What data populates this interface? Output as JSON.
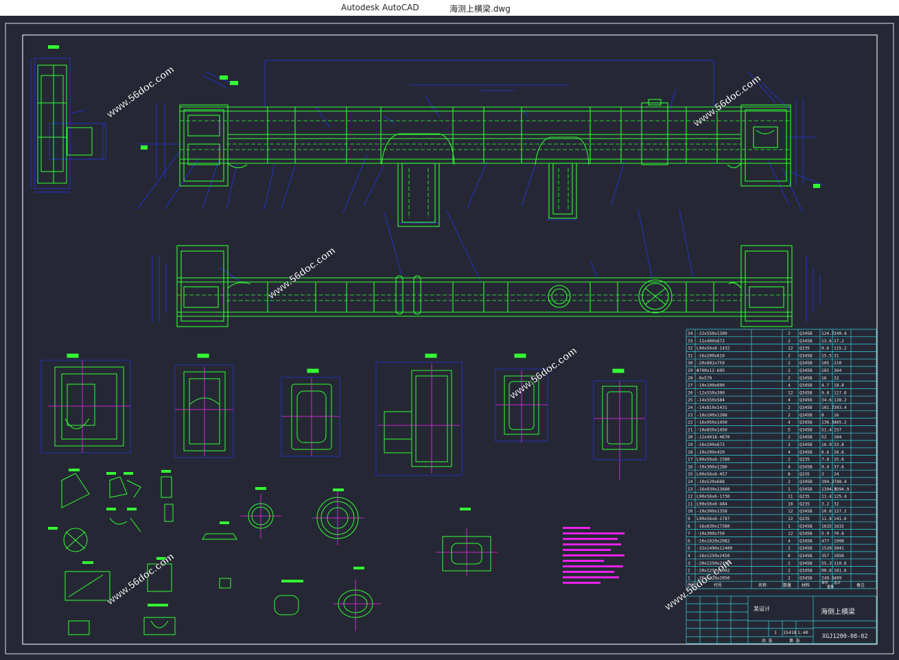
{
  "window": {
    "app_name": "Autodesk AutoCAD",
    "file_name": "海测上横梁.dwg"
  },
  "watermark": "www.56doc.com",
  "colors": {
    "background": "#252834",
    "frame": "#dfe4ea",
    "green": "#33ff33",
    "blue": "#2233ee",
    "cyan": "#33d6e6",
    "magenta": "#ff22ff",
    "white": "#e8e8e8",
    "watermark": "#ffffff"
  },
  "parts_table": {
    "rows": [
      [
        "34",
        "-22x550x1380",
        "2",
        "Q345B",
        "124.7",
        "249.4"
      ],
      [
        "33",
        "-11x400x672",
        "2",
        "Q345B",
        "13.6",
        "27.2"
      ],
      [
        "32",
        "L90x56x6-1432",
        "12",
        "Q235",
        "9.6",
        "115.2"
      ],
      [
        "31",
        "-16x200x616",
        "2",
        "Q345B",
        "15.5",
        "31"
      ],
      [
        "30",
        "-20x882x759",
        "2",
        "Q345B",
        "105",
        "210"
      ],
      [
        "29",
        "Φ700x12-695",
        "2",
        "Q345B",
        "182",
        "364"
      ],
      [
        "28",
        "-8x570",
        "2",
        "Q345B",
        "16",
        "32"
      ],
      [
        "27",
        "-10x100x600",
        "4",
        "Q345B",
        "4.7",
        "18.8"
      ],
      [
        "26",
        "-12x550x300",
        "12",
        "Q345B",
        "9.8",
        "117.6"
      ],
      [
        "25",
        "-14x550x584",
        "4",
        "Q345B",
        "34.6",
        "138.2"
      ],
      [
        "24",
        "-14x810x1431",
        "2",
        "Q345B",
        "101.7",
        "203.4"
      ],
      [
        "23",
        "-10x100x1288",
        "2",
        "Q345B",
        "8",
        "16"
      ],
      [
        "22",
        "-16x950x1450",
        "4",
        "Q345B",
        "136.3",
        "465.2"
      ],
      [
        "21",
        "-10x850x1450",
        "5",
        "Q345B",
        "51.4",
        "257"
      ],
      [
        "20",
        "-12x4918-4670",
        "2",
        "Q345B",
        "52",
        "104"
      ],
      [
        "19",
        "-16x200x672",
        "2",
        "Q345B",
        "16.9",
        "33.8"
      ],
      [
        "18",
        "-10x200x420",
        "4",
        "Q345B",
        "6.6",
        "26.6"
      ],
      [
        "17",
        "L90x56x6-2380",
        "2",
        "Q235",
        "7.8",
        "15.6"
      ],
      [
        "16",
        "-10x300x1280",
        "4",
        "Q345B",
        "9.4",
        "37.6"
      ],
      [
        "15",
        "L90x56x6-457",
        "8",
        "Q235",
        "3",
        "24"
      ],
      [
        "14",
        "-10x520x688",
        "2",
        "Q345B",
        "394.2",
        "788.4"
      ],
      [
        "13",
        "-16x930x13680",
        "1",
        "Q345B",
        "1394.9",
        "1394.9"
      ],
      [
        "12",
        "L90x56x6-1730",
        "11",
        "Q235",
        "11.4",
        "125.4"
      ],
      [
        "11",
        "L90x56x6-484",
        "10",
        "Q235",
        "3.2",
        "32"
      ],
      [
        "10",
        "-10x300x1358",
        "12",
        "Q345B",
        "10.6",
        "127.2"
      ],
      [
        "9",
        "L90x56x6-1787",
        "12",
        "Q235",
        "11.8",
        "141.6"
      ],
      [
        "8",
        "-16x830x17380",
        "1",
        "Q345B",
        "1632",
        "1632"
      ],
      [
        "7",
        "-10x300x750",
        "12",
        "Q345B",
        "5.9",
        "70.8"
      ],
      [
        "6",
        "-26x1620x2082",
        "4",
        "Q345B",
        "477",
        "1908"
      ],
      [
        "5",
        "-32x1490x12400",
        "2",
        "Q345B",
        "1520",
        "3041"
      ],
      [
        "4",
        "-16x1250x2450",
        "8",
        "Q345B",
        "357",
        "2856"
      ],
      [
        "3",
        "-20x1250x2450",
        "2",
        "Q345B",
        "55.3",
        "110.6"
      ],
      [
        "2",
        "-20x1250x2082",
        "2",
        "Q345B",
        "90.8",
        "181.6"
      ],
      [
        "1",
        "-26x1620x2050",
        "2",
        "Q345B",
        "249.5",
        "499"
      ]
    ],
    "header": {
      "seq": "序号",
      "code": "代号",
      "name": "名称",
      "qty": "数量",
      "material": "材料",
      "unit_weight": "单件",
      "total_weight": "总计",
      "weight": "重量",
      "remarks": "备注"
    }
  },
  "title_block": {
    "company": "某设计",
    "drawing_title": "海侧上横梁",
    "drawing_no": "XGJ1200-08-02",
    "weight": "15418",
    "scale": "1:40",
    "sheet_qty": "1",
    "sheet_label_1": "共 张",
    "sheet_label_2": "第 张"
  }
}
